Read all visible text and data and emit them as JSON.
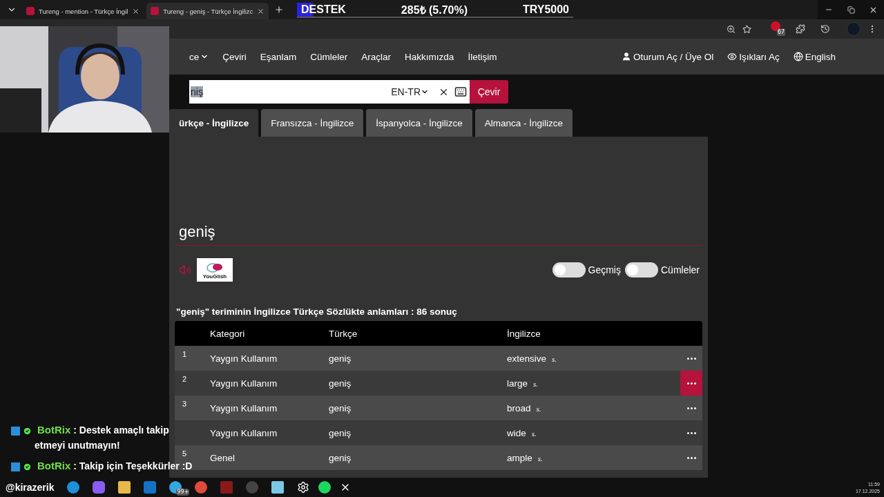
{
  "browser": {
    "tabs": [
      {
        "title": "Tureng - mention - Türkçe İngil",
        "selected": false
      },
      {
        "title": "Tureng - geniş - Türkçe İngilizc",
        "selected": true
      }
    ],
    "extension_badge": "67"
  },
  "stream_goal": {
    "label": "DESTEK",
    "amount": "285₺ (5.70%)",
    "target": "TRY5000",
    "level": 0.057
  },
  "nav": {
    "items": [
      {
        "label": "ce",
        "dropdown": true
      },
      {
        "label": "Çeviri",
        "dropdown": false
      },
      {
        "label": "Eşanlam",
        "dropdown": false
      },
      {
        "label": "Cümleler",
        "dropdown": false
      },
      {
        "label": "Araçlar",
        "dropdown": false
      },
      {
        "label": "Hakkımızda",
        "dropdown": false
      },
      {
        "label": "İletişim",
        "dropdown": false
      }
    ],
    "account": [
      {
        "label": "Oturum Aç / Üye Ol",
        "kind": "user"
      },
      {
        "label": "Işıkları Aç",
        "kind": "eye"
      },
      {
        "label": "English",
        "kind": "globe"
      }
    ]
  },
  "search": {
    "value": "niş",
    "value_selected": true,
    "language": "EN-TR",
    "button": "Çevir"
  },
  "dictionary_tabs": [
    {
      "label": "ürkçe - İngilizce",
      "selected": true
    },
    {
      "label": "Fransızca - İngilizce",
      "selected": false
    },
    {
      "label": "İspanyolca - İngilizce",
      "selected": false
    },
    {
      "label": "Almanca - İngilizce",
      "selected": false
    }
  ],
  "term": {
    "heading": "geniş",
    "youglish_label": "YouGlish",
    "toggles": [
      {
        "label": "Geçmiş",
        "on": false
      },
      {
        "label": "Cümleler",
        "on": false
      }
    ],
    "result_summary": "\"geniş\" teriminin İngilizce Türkçe Sözlükte anlamları : 86 sonuç"
  },
  "table": {
    "columns": [
      "Kategori",
      "Türkçe",
      "İngilizce"
    ],
    "rows": [
      {
        "number": "1",
        "category": "Yaygın Kullanım",
        "turkish": "geniş",
        "english": "extensive",
        "pos": "s.",
        "menu_active": false
      },
      {
        "number": "2",
        "category": "Yaygın Kullanım",
        "turkish": "geniş",
        "english": "large",
        "pos": "s.",
        "menu_active": true
      },
      {
        "number": "3",
        "category": "Yaygın Kullanım",
        "turkish": "geniş",
        "english": "broad",
        "pos": "s.",
        "menu_active": false
      },
      {
        "category": "Yaygın Kullanım",
        "turkish": "geniş",
        "english": "wide",
        "pos": "s.",
        "menu_active": false
      },
      {
        "number": "5",
        "category": "Genel",
        "turkish": "geniş",
        "english": "ample",
        "pos": "s.",
        "menu_active": false
      }
    ]
  },
  "chat": {
    "messages": [
      {
        "user": "BotRix",
        "text": ": Destek amaçlı takip etmeyi unutmayın!"
      },
      {
        "user": "BotRix",
        "text": ": Takip için Teşekkürler :D"
      }
    ],
    "handle": "@kirazerik"
  },
  "taskbar": {
    "badge": "99+",
    "time": "11:59",
    "date": "17.12.2025"
  }
}
